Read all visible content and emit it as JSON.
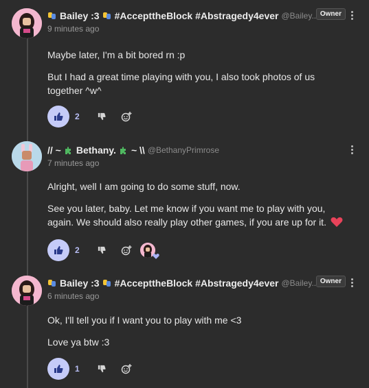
{
  "posts": [
    {
      "author": "Bailey :3",
      "tags": "#AccepttheBlock #Abstragedy4ever",
      "handle": "@Bailey...",
      "owner_badge": "Owner",
      "time": "9 minutes ago",
      "paragraphs": [
        "Maybe later, I'm a bit bored rn :p",
        "But I had a great time playing with you, I also took photos of us together ^w^"
      ],
      "likes": "2",
      "avatar": "avatar-pink-bg",
      "badge_icons": [
        "comedy-tragedy-masks-icon",
        "comedy-tragedy-masks-icon"
      ]
    },
    {
      "author_prefix": "// ~",
      "author": "Bethany.",
      "author_suffix": "~ \\\\",
      "handle": "@BethanyPrimrose",
      "time": "7 minutes ago",
      "paragraphs": [
        "Alright, well I am going to do some stuff, now.",
        "See you later, baby. Let me know if you want me to play with you, again. We should also really play other games, if you are up for it."
      ],
      "likes": "2",
      "avatar": "avatar-blue-bg",
      "badge_icons": [
        "puzzle-piece-icon",
        "puzzle-piece-icon"
      ],
      "emoji": "heart-emoji"
    },
    {
      "author": "Bailey :3",
      "tags": "#AccepttheBlock #Abstragedy4ever",
      "handle": "@Bailey...",
      "owner_badge": "Owner",
      "time": "6 minutes ago",
      "paragraphs": [
        "Ok, I'll tell you if I want you to play with me <3",
        "Love ya btw :3"
      ],
      "likes": "1",
      "avatar": "avatar-pink-bg",
      "badge_icons": [
        "comedy-tragedy-masks-icon",
        "comedy-tragedy-masks-icon"
      ]
    }
  ],
  "colors": {
    "background": "#2c2c2c",
    "like_button": "#c5cbf8",
    "count": "#b8bef5",
    "heart": "#e8435a"
  }
}
